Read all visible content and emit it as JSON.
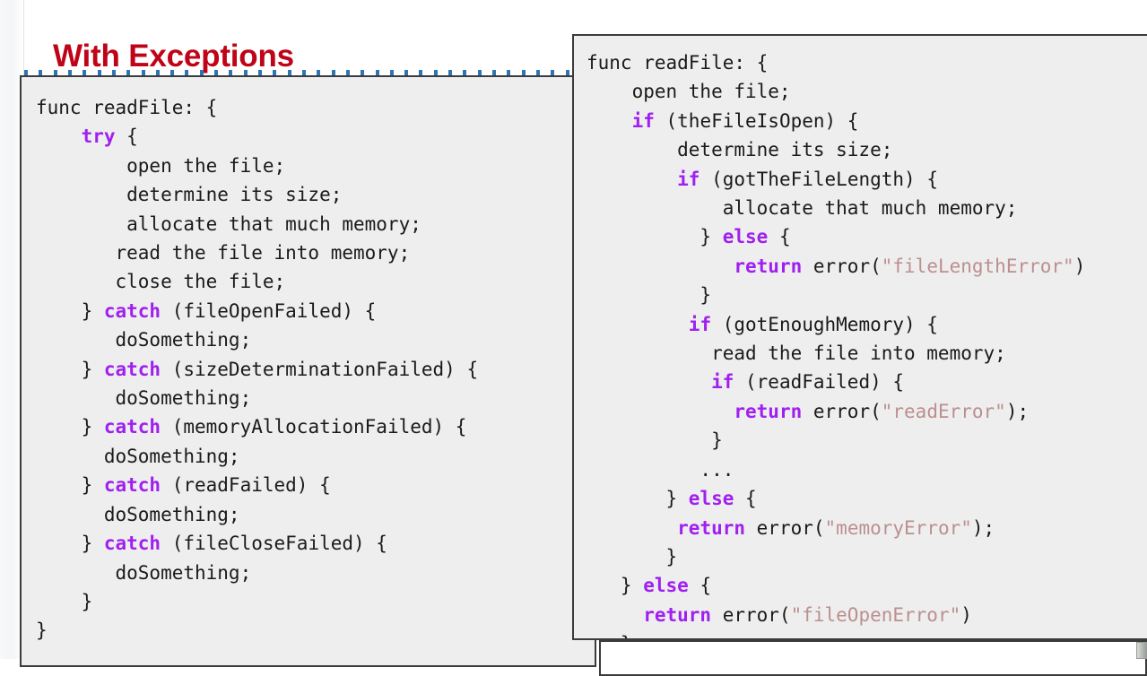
{
  "slide": {
    "title": "With Exceptions",
    "title_color": "#c00418",
    "background_color": "#ffffff"
  },
  "theme": {
    "code_background": "#eeeeee",
    "code_border": "#3b3b3b",
    "code_text": "#1a1a1a",
    "keyword_color": "#a020f0",
    "string_color": "#bc8f8f",
    "selection_dot_color": "#2e75b6"
  },
  "selection_guide": {
    "dot_count": 38
  },
  "panels": [
    {
      "name": "exceptions-version",
      "lines": [
        [
          {
            "t": "func readFile: {"
          }
        ],
        [
          {
            "t": "    "
          },
          {
            "t": "try",
            "c": "kw"
          },
          {
            "t": " {"
          }
        ],
        [
          {
            "t": "        open the file;"
          }
        ],
        [
          {
            "t": "        determine its size;"
          }
        ],
        [
          {
            "t": "        allocate that much memory;"
          }
        ],
        [
          {
            "t": "       read the file into memory;"
          }
        ],
        [
          {
            "t": "       close the file;"
          }
        ],
        [
          {
            "t": "    } "
          },
          {
            "t": "catch",
            "c": "kw"
          },
          {
            "t": " (fileOpenFailed) {"
          }
        ],
        [
          {
            "t": "       doSomething;"
          }
        ],
        [
          {
            "t": "    } "
          },
          {
            "t": "catch",
            "c": "kw"
          },
          {
            "t": " (sizeDeterminationFailed) {"
          }
        ],
        [
          {
            "t": "       doSomething;"
          }
        ],
        [
          {
            "t": "    } "
          },
          {
            "t": "catch",
            "c": "kw"
          },
          {
            "t": " (memoryAllocationFailed) {"
          }
        ],
        [
          {
            "t": "      doSomething;"
          }
        ],
        [
          {
            "t": "    } "
          },
          {
            "t": "catch",
            "c": "kw"
          },
          {
            "t": " (readFailed) {"
          }
        ],
        [
          {
            "t": "      doSomething;"
          }
        ],
        [
          {
            "t": "    } "
          },
          {
            "t": "catch",
            "c": "kw"
          },
          {
            "t": " (fileCloseFailed) {"
          }
        ],
        [
          {
            "t": "       doSomething;"
          }
        ],
        [
          {
            "t": "    }"
          }
        ],
        [
          {
            "t": "}"
          }
        ]
      ]
    },
    {
      "name": "error-codes-version",
      "lines": [
        [
          {
            "t": "func readFile: {"
          }
        ],
        [
          {
            "t": "    open the file;"
          }
        ],
        [
          {
            "t": "    "
          },
          {
            "t": "if",
            "c": "kw"
          },
          {
            "t": " (theFileIsOpen) {"
          }
        ],
        [
          {
            "t": "        determine its size;"
          }
        ],
        [
          {
            "t": "        "
          },
          {
            "t": "if",
            "c": "kw"
          },
          {
            "t": " (gotTheFileLength) {"
          }
        ],
        [
          {
            "t": "            allocate that much memory;"
          }
        ],
        [
          {
            "t": "          } "
          },
          {
            "t": "else",
            "c": "kw"
          },
          {
            "t": " {"
          }
        ],
        [
          {
            "t": "             "
          },
          {
            "t": "return",
            "c": "kw"
          },
          {
            "t": " error("
          },
          {
            "t": "\"fileLengthError\"",
            "c": "str"
          },
          {
            "t": ")"
          }
        ],
        [
          {
            "t": "          }"
          }
        ],
        [
          {
            "t": "         "
          },
          {
            "t": "if",
            "c": "kw"
          },
          {
            "t": " (gotEnoughMemory) {"
          }
        ],
        [
          {
            "t": "           read the file into memory;"
          }
        ],
        [
          {
            "t": "           "
          },
          {
            "t": "if",
            "c": "kw"
          },
          {
            "t": " (readFailed) {"
          }
        ],
        [
          {
            "t": "             "
          },
          {
            "t": "return",
            "c": "kw"
          },
          {
            "t": " error("
          },
          {
            "t": "\"readError\"",
            "c": "str"
          },
          {
            "t": ");"
          }
        ],
        [
          {
            "t": "           }"
          }
        ],
        [
          {
            "t": "          ..."
          }
        ],
        [
          {
            "t": "       } "
          },
          {
            "t": "else",
            "c": "kw"
          },
          {
            "t": " {"
          }
        ],
        [
          {
            "t": "        "
          },
          {
            "t": "return",
            "c": "kw"
          },
          {
            "t": " error("
          },
          {
            "t": "\"memoryError\"",
            "c": "str"
          },
          {
            "t": ");"
          }
        ],
        [
          {
            "t": "       }"
          }
        ],
        [
          {
            "t": "   } "
          },
          {
            "t": "else",
            "c": "kw"
          },
          {
            "t": " {"
          }
        ],
        [
          {
            "t": "     "
          },
          {
            "t": "return",
            "c": "kw"
          },
          {
            "t": " error("
          },
          {
            "t": "\"fileOpenError\"",
            "c": "str"
          },
          {
            "t": ")"
          }
        ],
        [
          {
            "t": "   }"
          }
        ]
      ]
    }
  ]
}
